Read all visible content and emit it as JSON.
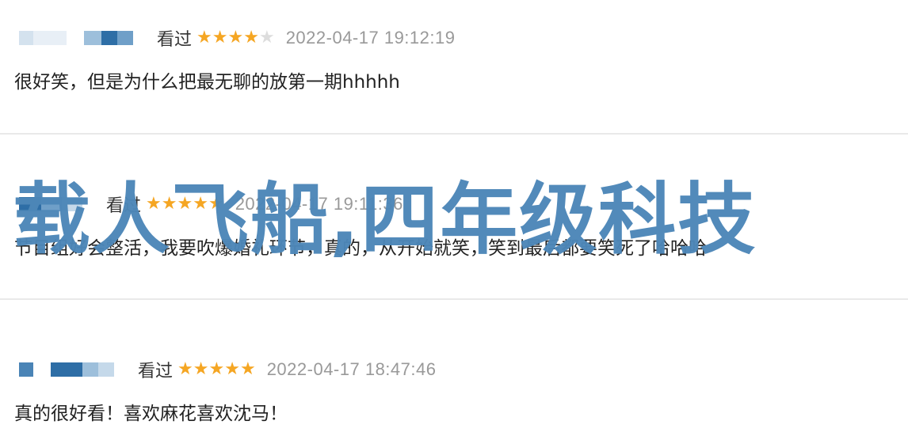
{
  "colors": {
    "star_filled": "#f5a623",
    "star_empty": "#dddddd",
    "date_text": "#999999",
    "overlay_title": "#4d87b8",
    "avatar_dark": "#2e6ea6",
    "avatar_mid": "#6f9fc8",
    "avatar_light": "#c5d9ea",
    "avatar_pale": "#e4edf5"
  },
  "overlay": {
    "title": "载人飞船,四年级科技"
  },
  "reviews": [
    {
      "rating_label": "看过",
      "stars_filled": 4,
      "stars_total": 5,
      "date": "2022-04-17 19:12:19",
      "comment": "很好笑，但是为什么把最无聊的放第一期hhhhh"
    },
    {
      "rating_label": "看过",
      "stars_filled": 5,
      "stars_total": 5,
      "date": "2022-04-17 19:11:36",
      "comment": "节目组好会整活，我要吹爆婚礼环节，真的，从开始就笑，笑到最后都要笑死了哈哈哈"
    },
    {
      "rating_label": "看过",
      "stars_filled": 5,
      "stars_total": 5,
      "date": "2022-04-17 18:47:46",
      "comment": "真的很好看！喜欢麻花喜欢沈马！"
    }
  ]
}
